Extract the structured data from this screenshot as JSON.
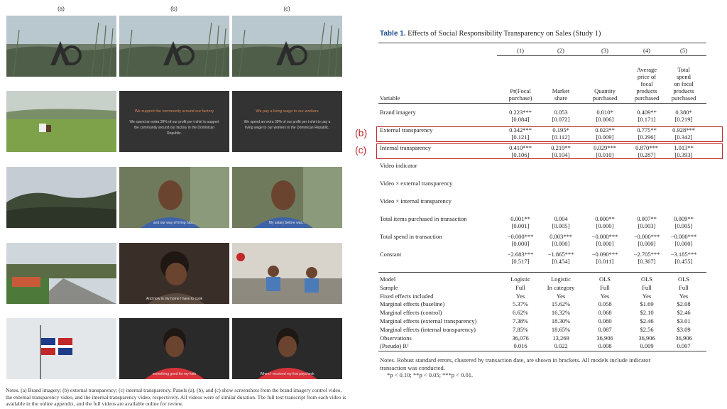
{
  "figure": {
    "column_labels": [
      "(a)",
      "(b)",
      "(c)"
    ],
    "logo_text": "AG",
    "slide_b": {
      "heading": "We support the community around our factory",
      "body": "We spend an extra 39% of our profit per t-shirt to support the community around our factory in the Dominican Republic."
    },
    "slide_c": {
      "heading": "We pay a living wage to our workers",
      "body": "We spend an extra 39% of our profit per t-shirt to pay a living wage to our workers in the Dominican Republic."
    },
    "subtitles": {
      "r3b": "and our way of living has...",
      "r3c": "My salary before was...",
      "r4b": "And now in my home I have to cook",
      "r5b": "something good for my kids",
      "r5c": "When I received my first paycheck"
    },
    "notes": "Notes. (a) Brand imagery; (b) external transparency; (c) internal transparency. Panels (a), (b), and (c) show screenshots from the brand imagery control video, the external transparency video, and the internal transparency video, respectively. All videos were of similar duration. The full text transcript from each video is available in the online appendix, and the full videos are available online for review."
  },
  "table": {
    "label": "Table 1.",
    "title": "Effects of Social Responsibility Transparency on Sales (Study 1)",
    "col_numbers": [
      "(1)",
      "(2)",
      "(3)",
      "(4)",
      "(5)"
    ],
    "col_headers": [
      [
        "Pr(Focal",
        "purchase)"
      ],
      [
        "Market",
        "share"
      ],
      [
        "Quantity",
        "purchased"
      ],
      [
        "Average",
        "price of",
        "focal",
        "products",
        "purchased"
      ],
      [
        "Total",
        "spend",
        "on focal",
        "products",
        "purchased"
      ]
    ],
    "variable_header": "Variable",
    "rows": [
      {
        "label": "Brand imagery",
        "est": [
          "0.223***",
          "0.053",
          "0.010*",
          "0.409**",
          "0.380*"
        ],
        "se": [
          "[0.084]",
          "[0.072]",
          "[0.006]",
          "[0.171]",
          "[0.219]"
        ]
      },
      {
        "label": "External transparency",
        "est": [
          "0.342***",
          "0.195*",
          "0.023**",
          "0.775**",
          "0.928***"
        ],
        "se": [
          "[0.121]",
          "[0.112]",
          "[0.009]",
          "[0.296]",
          "[0.342]"
        ]
      },
      {
        "label": "Internal transparency",
        "est": [
          "0.410***",
          "0.219**",
          "0.029***",
          "0.870***",
          "1.013**"
        ],
        "se": [
          "[0.106]",
          "[0.104]",
          "[0.010]",
          "[0.287]",
          "[0.393]"
        ]
      },
      {
        "label": "Video indicator",
        "est": [
          "",
          "",
          "",
          "",
          ""
        ],
        "se": [
          "",
          "",
          "",
          "",
          ""
        ]
      },
      {
        "label": "Video × external transparency",
        "est": [
          "",
          "",
          "",
          "",
          ""
        ],
        "se": [
          "",
          "",
          "",
          "",
          ""
        ]
      },
      {
        "label": "Video × internal transparency",
        "est": [
          "",
          "",
          "",
          "",
          ""
        ],
        "se": [
          "",
          "",
          "",
          "",
          ""
        ]
      },
      {
        "label": "Total items purchased in transaction",
        "est": [
          "0.001**",
          "0.004",
          "0.000**",
          "0.007**",
          "0.009**"
        ],
        "se": [
          "[0.001]",
          "[0.005]",
          "[0.000]",
          "[0.003]",
          "[0.005]"
        ]
      },
      {
        "label": "Total spend in transaction",
        "est": [
          "−0.000***",
          "0.003***",
          "−0.000***",
          "−0.000***",
          "−0.000***"
        ],
        "se": [
          "[0.000]",
          "[0.000]",
          "[0.000]",
          "[0.000]",
          "[0.000]"
        ]
      },
      {
        "label": "Constant",
        "est": [
          "−2.683***",
          "−1.865***",
          "−0.090***",
          "−2.705***",
          "−3.185***"
        ],
        "se": [
          "[0.517]",
          "[0.454]",
          "[0.011]",
          "[0.367]",
          "[0.455]"
        ]
      }
    ],
    "stats": [
      {
        "label": "Model",
        "vals": [
          "Logistic",
          "Logistic",
          "OLS",
          "OLS",
          "OLS"
        ]
      },
      {
        "label": "Sample",
        "vals": [
          "Full",
          "In category",
          "Full",
          "Full",
          "Full"
        ]
      },
      {
        "label": "Fixed effects included",
        "vals": [
          "Yes",
          "Yes",
          "Yes",
          "Yes",
          "Yes"
        ]
      },
      {
        "label": "Marginal effects (baseline)",
        "vals": [
          "5.37%",
          "15.62%",
          "0.058",
          "$1.69",
          "$2.08"
        ]
      },
      {
        "label": "Marginal effects (control)",
        "vals": [
          "6.62%",
          "16.32%",
          "0.068",
          "$2.10",
          "$2.46"
        ]
      },
      {
        "label": "Marginal effects (external transparency)",
        "vals": [
          "7.38%",
          "18.30%",
          "0.080",
          "$2.46",
          "$3.01"
        ]
      },
      {
        "label": "Marginal effects (internal transparency)",
        "vals": [
          "7.85%",
          "18.65%",
          "0.087",
          "$2.56",
          "$3.09"
        ]
      },
      {
        "label": "Observations",
        "vals": [
          "36,076",
          "13,269",
          "36,906",
          "36,906",
          "36,906"
        ]
      },
      {
        "label": "(Pseudo) R²",
        "vals": [
          "0.016",
          "0.022",
          "0.008",
          "0.009",
          "0.007"
        ]
      }
    ],
    "notes_line1": "Notes. Robust standard errors, clustered by transaction date, are shown in brackets. All models include indicator",
    "notes_line2": "transaction was conducted.",
    "notes_line3": "*p < 0.10; **p < 0.05; ***p < 0.01.",
    "highlight_labels": [
      "(b)",
      "(c)"
    ],
    "highlight_color": "#c0282a"
  }
}
